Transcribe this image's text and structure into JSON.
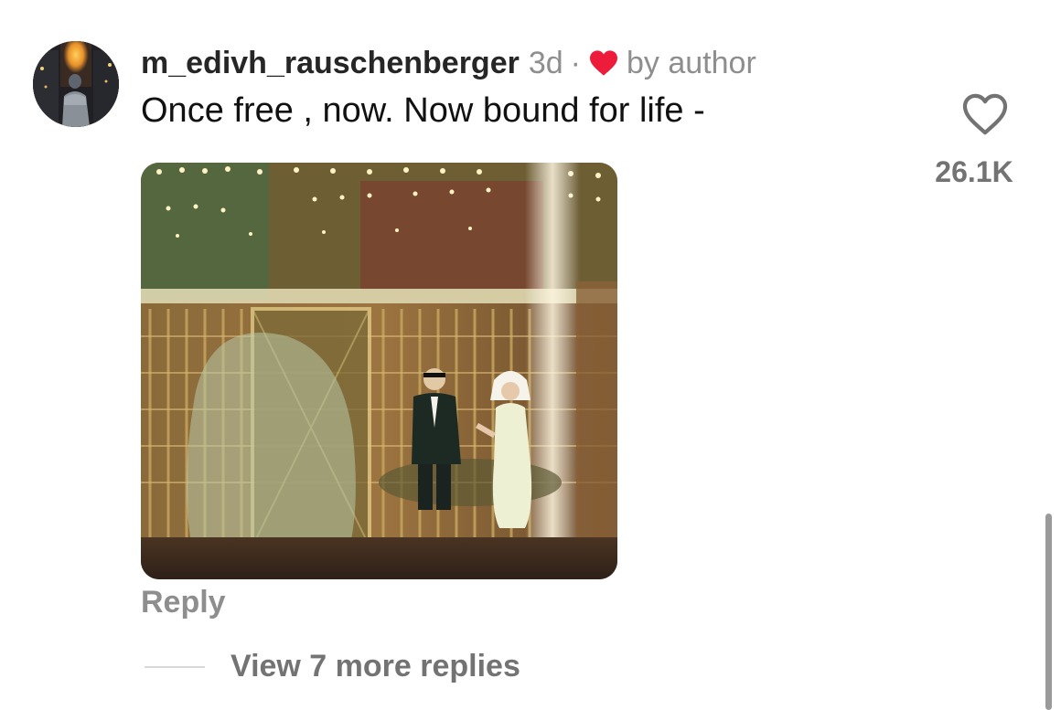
{
  "comment": {
    "username": "m_edivh_rauschenberger",
    "time": "3d",
    "separator": "·",
    "author_badge": "by author",
    "text": "Once free , now. Now bound for life -",
    "like_count": "26.1K",
    "reply_label": "Reply",
    "view_replies_label": "View 7 more replies"
  },
  "icons": {
    "author_heart": "heart-filled-icon",
    "like": "heart-outline-icon"
  },
  "colors": {
    "username": "#262626",
    "muted_text": "#8e8e8e",
    "author_heart": "#ed1c3a",
    "comment_text": "#111111"
  }
}
